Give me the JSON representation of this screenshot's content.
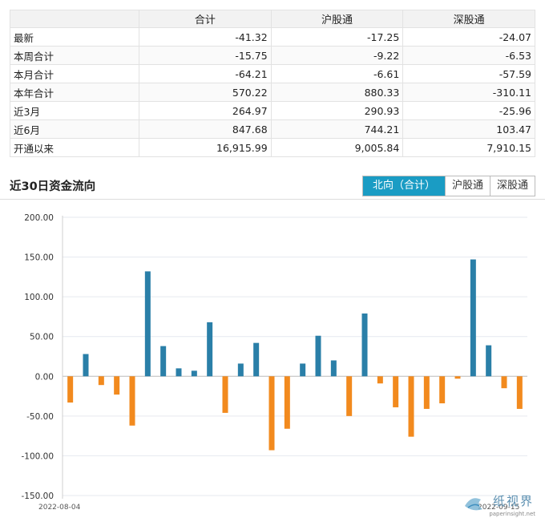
{
  "summary_table": {
    "headers": [
      "",
      "合计",
      "沪股通",
      "深股通"
    ],
    "rows": [
      {
        "label": "最新",
        "total": "-41.32",
        "sh": "-17.25",
        "sz": "-24.07"
      },
      {
        "label": "本周合计",
        "total": "-15.75",
        "sh": "-9.22",
        "sz": "-6.53"
      },
      {
        "label": "本月合计",
        "total": "-64.21",
        "sh": "-6.61",
        "sz": "-57.59"
      },
      {
        "label": "本年合计",
        "total": "570.22",
        "sh": "880.33",
        "sz": "-310.11"
      },
      {
        "label": "近3月",
        "total": "264.97",
        "sh": "290.93",
        "sz": "-25.96"
      },
      {
        "label": "近6月",
        "total": "847.68",
        "sh": "744.21",
        "sz": "103.47"
      },
      {
        "label": "开通以来",
        "total": "16,915.99",
        "sh": "9,005.84",
        "sz": "7,910.15"
      }
    ]
  },
  "section_title": "近30日资金流向",
  "tabs": [
    {
      "label": "北向（合计）",
      "active": true
    },
    {
      "label": "沪股通",
      "active": false
    },
    {
      "label": "深股通",
      "active": false
    }
  ],
  "watermark": {
    "text": "纸视界",
    "sub": "paperinsight.net"
  },
  "chart_data": {
    "type": "bar",
    "title": "",
    "xlabel": "",
    "ylabel": "",
    "ylim": [
      -150,
      200
    ],
    "yticks": [
      "200.00",
      "150.00",
      "100.00",
      "50.00",
      "0.00",
      "-50.00",
      "-100.00",
      "-150.00"
    ],
    "x_first_label": "2022-08-04",
    "x_last_label": "2022-09-15",
    "positive_color": "#2a7fa8",
    "negative_color": "#f28a1e",
    "grid": true,
    "values": [
      -33,
      28,
      -11,
      -23,
      -62,
      132,
      38,
      10,
      7,
      68,
      -46,
      16,
      42,
      -93,
      -66,
      16,
      51,
      20,
      -50,
      79,
      -9,
      -39,
      -76,
      -41,
      -34,
      -3,
      147,
      39,
      -15,
      -41
    ]
  }
}
